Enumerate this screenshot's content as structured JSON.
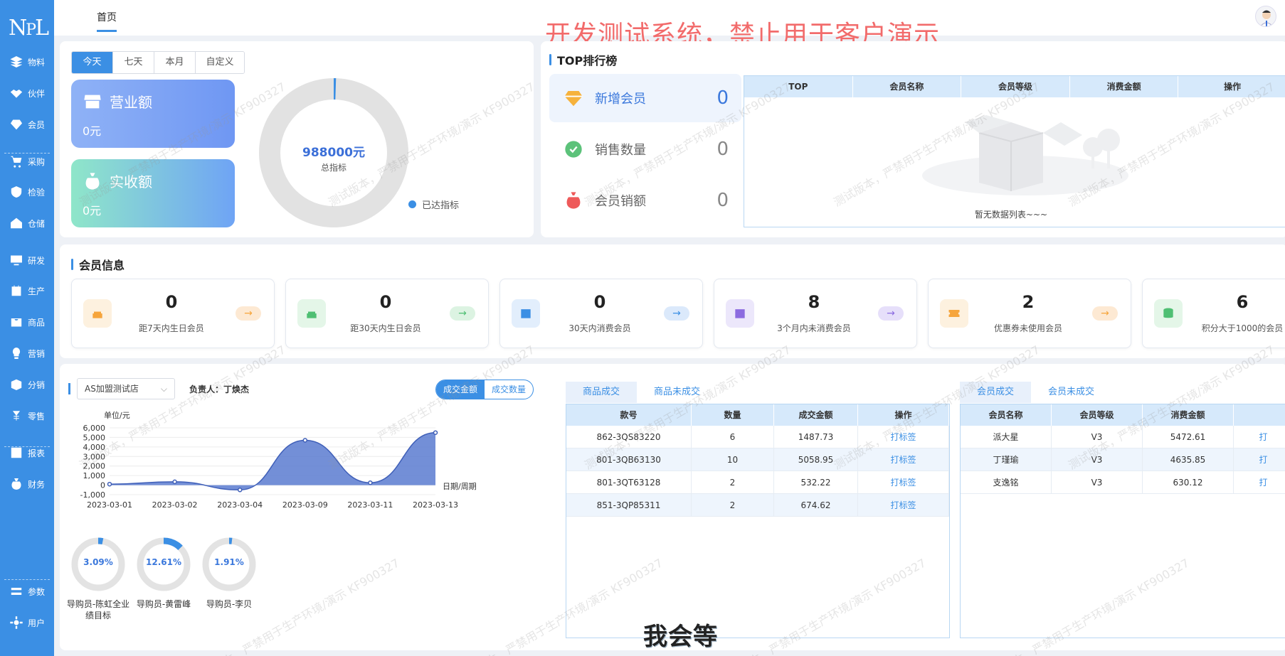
{
  "app": {
    "logo_text": "NPL"
  },
  "sidebar": {
    "items": [
      {
        "label": "物料",
        "icon": "layers-icon"
      },
      {
        "label": "伙伴",
        "icon": "handshake-icon"
      },
      {
        "label": "会员",
        "icon": "diamond-icon"
      },
      {
        "label": "采购",
        "icon": "cart-icon"
      },
      {
        "label": "检验",
        "icon": "shield-icon"
      },
      {
        "label": "仓储",
        "icon": "warehouse-icon"
      },
      {
        "label": "研发",
        "icon": "monitor-icon"
      },
      {
        "label": "生产",
        "icon": "calendar-icon"
      },
      {
        "label": "商品",
        "icon": "bag-icon"
      },
      {
        "label": "营销",
        "icon": "bulb-icon"
      },
      {
        "label": "分销",
        "icon": "box-icon"
      },
      {
        "label": "零售",
        "icon": "yen-icon"
      },
      {
        "label": "报表",
        "icon": "chart-icon"
      },
      {
        "label": "财务",
        "icon": "money-bag-icon"
      },
      {
        "label": "参数",
        "icon": "sliders-icon"
      },
      {
        "label": "用户",
        "icon": "gear-icon"
      }
    ]
  },
  "topbar": {
    "home_tab": "首页",
    "banner": "开发测试系统，禁止用于客户演示"
  },
  "sales": {
    "period_tabs": [
      "今天",
      "七天",
      "本月",
      "自定义"
    ],
    "revenue_label": "营业额",
    "revenue_value": "0元",
    "received_label": "实收额",
    "received_value": "0元",
    "target_value": "988000元",
    "target_label": "总指标",
    "reached_legend": "已达指标",
    "reached_fraction": 0.005
  },
  "top": {
    "title": "TOP排行榜",
    "metrics": [
      {
        "label": "新增会员",
        "value": "0"
      },
      {
        "label": "销售数量",
        "value": "0"
      },
      {
        "label": "会员销额",
        "value": "0"
      }
    ],
    "table_headers": [
      "TOP",
      "会员名称",
      "会员等级",
      "消费金额",
      "操作"
    ],
    "empty_text": "暂无数据列表~~~"
  },
  "members": {
    "title": "会员信息",
    "cards": [
      {
        "value": "0",
        "label": "距7天内生日会员",
        "icon": "cake-icon",
        "tint": "#fdf1df",
        "color": "#f6a53c",
        "arrow_bg": "#fde9d3"
      },
      {
        "value": "0",
        "label": "距30天内生日会员",
        "icon": "cake-icon",
        "tint": "#e4f6e8",
        "color": "#4fbf73",
        "arrow_bg": "#dcf3e2"
      },
      {
        "value": "0",
        "label": "30天内消费会员",
        "icon": "calendar-icon",
        "tint": "#e2eefc",
        "color": "#3b8fe4",
        "arrow_bg": "#dbe9fb"
      },
      {
        "value": "8",
        "label": "3个月内未消费会员",
        "icon": "calendar-icon",
        "tint": "#ece7fb",
        "color": "#8c6be0",
        "arrow_bg": "#e6dffa"
      },
      {
        "value": "2",
        "label": "优惠券未使用会员",
        "icon": "coupon-icon",
        "tint": "#fdf1df",
        "color": "#f6a53c",
        "arrow_bg": "#fde9d3"
      },
      {
        "value": "6",
        "label": "积分大于1000的会员",
        "icon": "coins-icon",
        "tint": "#e4f6e8",
        "color": "#4fbf73",
        "arrow_bg": "#dcf3e2"
      }
    ]
  },
  "bottom": {
    "store": "AS加盟测试店",
    "manager": "负责人：丁焕杰",
    "toggle": [
      "成交金额",
      "成交数量"
    ],
    "rings": [
      {
        "value": "3.09%",
        "fraction": 0.0309,
        "label": "导购员-陈虹全业绩目标"
      },
      {
        "value": "12.61%",
        "fraction": 0.1261,
        "label": "导购员-黄雷峰"
      },
      {
        "value": "1.91%",
        "fraction": 0.0191,
        "label": "导购员-李贝"
      }
    ],
    "goods_tabs": [
      "商品成交",
      "商品未成交"
    ],
    "goods_headers": [
      "款号",
      "数量",
      "成交金额",
      "操作"
    ],
    "goods_rows": [
      [
        "862-3QS83220",
        "6",
        "1487.73",
        "打标签"
      ],
      [
        "801-3QB63130",
        "10",
        "5058.95",
        "打标签"
      ],
      [
        "801-3QT63128",
        "2",
        "532.22",
        "打标签"
      ],
      [
        "851-3QP85311",
        "2",
        "674.62",
        "打标签"
      ]
    ],
    "member_tabs": [
      "会员成交",
      "会员未成交"
    ],
    "member_headers": [
      "会员名称",
      "会员等级",
      "消费金额",
      ""
    ],
    "member_rows": [
      [
        "派大星",
        "V3",
        "5472.61",
        "打"
      ],
      [
        "丁瑾瑜",
        "V3",
        "4635.85",
        "打"
      ],
      [
        "支逸铭",
        "V3",
        "630.12",
        "打"
      ]
    ]
  },
  "chart_data": {
    "type": "area",
    "ylabel": "单位/元",
    "xlabel": "日期/周期",
    "x": [
      "2023-03-01",
      "2023-03-02",
      "2023-03-04",
      "2023-03-09",
      "2023-03-11",
      "2023-03-13"
    ],
    "yticks": [
      "6,000",
      "5,000",
      "4,000",
      "3,000",
      "2,000",
      "1,000",
      "0",
      "-1,000"
    ],
    "values": [
      100,
      350,
      -500,
      4700,
      250,
      5500
    ],
    "ylim": [
      -1000,
      6000
    ],
    "color": "#5b7bd0"
  },
  "overlay": {
    "wait_text": "我会等"
  },
  "watermark": "测试版本，严禁用于生产环境/演示 KF900327"
}
